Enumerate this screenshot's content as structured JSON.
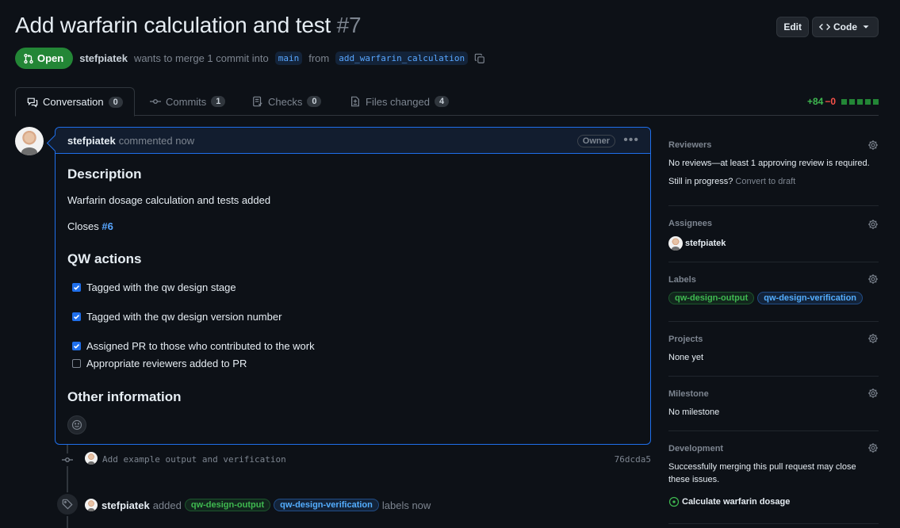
{
  "header": {
    "title": "Add warfarin calculation and test",
    "number": "#7",
    "edit_label": "Edit",
    "code_label": "Code"
  },
  "meta": {
    "state": "Open",
    "author": "stefpiatek",
    "text_merge": "wants to merge 1 commit into",
    "base_branch": "main",
    "text_from": "from",
    "head_branch": "add_warfarin_calculation"
  },
  "tabs": [
    {
      "label": "Conversation",
      "count": "0"
    },
    {
      "label": "Commits",
      "count": "1"
    },
    {
      "label": "Checks",
      "count": "0"
    },
    {
      "label": "Files changed",
      "count": "4"
    }
  ],
  "diffstat": {
    "additions": "+84",
    "deletions": "−0"
  },
  "comment": {
    "author": "stefpiatek",
    "action": "commented now",
    "role": "Owner",
    "description_heading": "Description",
    "description_text": "Warfarin dosage calculation and tests added",
    "closes_text": "Closes",
    "closes_ref": "#6",
    "actions_heading": "QW actions",
    "tasks": [
      {
        "label": "Tagged with the qw design stage",
        "checked": true
      },
      {
        "label": "Tagged with the qw design version number",
        "checked": true
      },
      {
        "label": "Assigned PR to those who contributed to the work",
        "checked": true
      },
      {
        "label": "Appropriate reviewers added to PR",
        "checked": false
      }
    ],
    "other_heading": "Other information"
  },
  "timeline": {
    "commit_message": "Add example output and verification",
    "commit_sha": "76dcda5",
    "event_author": "stefpiatek",
    "event_action": "added",
    "labels": [
      "qw-design-output",
      "qw-design-verification"
    ],
    "event_suffix": "labels now"
  },
  "sidebar": {
    "reviewers": {
      "title": "Reviewers",
      "text": "No reviews—at least 1 approving review is required.",
      "progress_q": "Still in progress?",
      "progress_link": "Convert to draft"
    },
    "assignees": {
      "title": "Assignees",
      "user": "stefpiatek"
    },
    "labels": {
      "title": "Labels",
      "items": [
        "qw-design-output",
        "qw-design-verification"
      ]
    },
    "projects": {
      "title": "Projects",
      "text": "None yet"
    },
    "milestone": {
      "title": "Milestone",
      "text": "No milestone"
    },
    "development": {
      "title": "Development",
      "text_1": "Successfully merging this pull request may close",
      "text_2": "these issues.",
      "issue": "Calculate warfarin dosage"
    }
  },
  "colors": {
    "accent": "#1f6feb",
    "open_green": "#238636",
    "link_blue": "#58a6ff",
    "background": "#0d1117"
  }
}
